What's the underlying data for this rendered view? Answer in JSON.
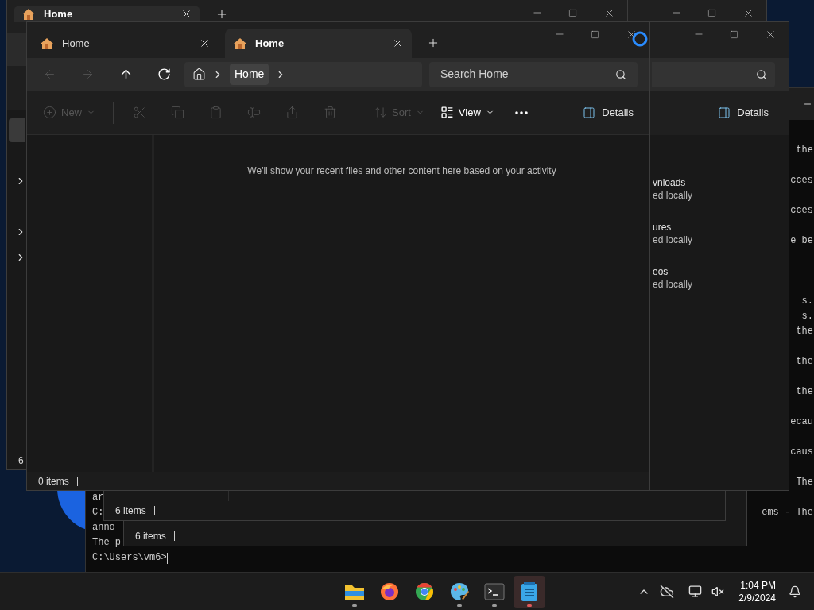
{
  "terminal": {
    "lines": [
      {
        "kind": "text",
        "right": "the"
      },
      {
        "kind": "blank"
      },
      {
        "kind": "text",
        "right": "cces"
      },
      {
        "kind": "blank"
      },
      {
        "kind": "text",
        "right": "cces"
      },
      {
        "kind": "blank"
      },
      {
        "kind": "text",
        "right": "e be"
      },
      {
        "kind": "blank"
      },
      {
        "kind": "blank"
      },
      {
        "kind": "blank"
      },
      {
        "kind": "text",
        "right": "s."
      },
      {
        "kind": "text",
        "right": "s."
      },
      {
        "kind": "text",
        "right": "the"
      },
      {
        "kind": "blank"
      },
      {
        "kind": "text",
        "right": "the"
      },
      {
        "kind": "blank"
      },
      {
        "kind": "text",
        "right": "the"
      },
      {
        "kind": "blank"
      },
      {
        "kind": "text",
        "right": "ecau"
      },
      {
        "kind": "blank"
      },
      {
        "kind": "text",
        "right": "caus"
      },
      {
        "kind": "blank"
      },
      {
        "kind": "text",
        "right": "The"
      },
      {
        "kind": "text",
        "left": "ar"
      },
      {
        "kind": "text",
        "left": "C:",
        "right": "ems - The"
      },
      {
        "kind": "text",
        "left": "anno"
      },
      {
        "kind": "text",
        "left": "The p"
      },
      {
        "kind": "prompt",
        "left": "C:\\Users\\vm6>"
      }
    ]
  },
  "back_window": {
    "tabs": [
      {
        "label": "Home",
        "selected": true
      }
    ],
    "sidebar_items": [
      {
        "kind": "item",
        "selected": true
      },
      {
        "kind": "spacer"
      },
      {
        "kind": "expander"
      },
      {
        "kind": "divider"
      },
      {
        "kind": "expander"
      },
      {
        "kind": "expander"
      }
    ],
    "status": "6"
  },
  "lower_windows": [
    {
      "status": "6 items"
    },
    {
      "status": "6 items"
    }
  ],
  "right_window": {
    "details_label": "Details",
    "items": [
      {
        "name": "vnloads",
        "detail": "ed locally"
      },
      {
        "name": "ures",
        "detail": "ed locally"
      },
      {
        "name": "eos",
        "detail": "ed locally"
      }
    ]
  },
  "front_window": {
    "tabs": [
      {
        "label": "Home",
        "selected": false
      },
      {
        "label": "Home",
        "selected": true
      }
    ],
    "nav": [
      {
        "kind": "back",
        "disabled": true
      },
      {
        "kind": "forward",
        "disabled": true
      },
      {
        "kind": "up",
        "disabled": false
      },
      {
        "kind": "refresh",
        "disabled": false
      }
    ],
    "breadcrumb": [
      "Home"
    ],
    "search": {
      "placeholder": "Search Home"
    },
    "commands": [
      {
        "kind": "new",
        "label": "New",
        "disabled": true
      },
      {
        "kind": "separator"
      },
      {
        "kind": "cut",
        "disabled": true
      },
      {
        "kind": "copy",
        "disabled": true
      },
      {
        "kind": "paste",
        "disabled": true
      },
      {
        "kind": "rename",
        "disabled": true
      },
      {
        "kind": "share",
        "disabled": true
      },
      {
        "kind": "delete",
        "disabled": true
      },
      {
        "kind": "separator"
      },
      {
        "kind": "sort",
        "label": "Sort",
        "disabled": true
      },
      {
        "kind": "view",
        "label": "View",
        "disabled": false
      },
      {
        "kind": "more",
        "disabled": false
      }
    ],
    "details_label": "Details",
    "empty_message": "We'll show your recent files and other content here based on your activity",
    "status": "0 items"
  },
  "taskbar": {
    "apps": [
      {
        "kind": "file-explorer",
        "running": true,
        "selected": false
      },
      {
        "kind": "firefox",
        "running": false,
        "selected": false
      },
      {
        "kind": "chrome",
        "running": false,
        "selected": false
      },
      {
        "kind": "paint",
        "running": true,
        "selected": false
      },
      {
        "kind": "terminal",
        "running": true,
        "selected": false
      },
      {
        "kind": "notepad",
        "running": true,
        "selected": true
      }
    ],
    "time": "1:04 PM",
    "date": "2/9/2024"
  }
}
